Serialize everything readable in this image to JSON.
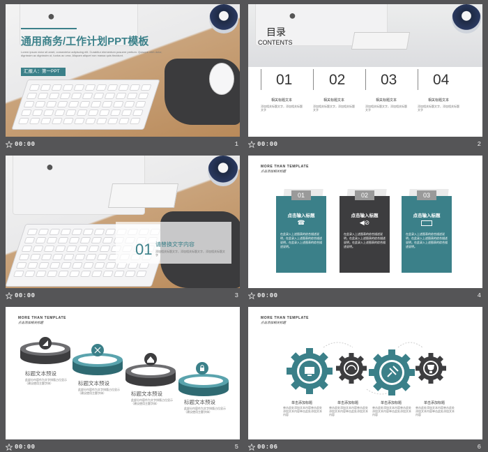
{
  "colors": {
    "accent": "#3b8089",
    "dark": "#3d3d3f",
    "grey": "#8a8a8a"
  },
  "slides": [
    {
      "number": "1",
      "time": "00:00",
      "title": "通用商务/工作计划PPT模板",
      "subtitle": "Lorem ipsum dolor sit amet, consectetur adipiscing elit. Curabitur elementum posuere pretium. Quisque nibh dolor, dignissim ac dignissim ut, luctus ac urna. Aliquam aliquet non massa quis tincidunt.",
      "reporter": "汇报人：第一PPT"
    },
    {
      "number": "2",
      "time": "00:00",
      "title": "目录",
      "subtitle": "CONTENTS",
      "items": [
        {
          "num": "01",
          "label": "相关标题文本",
          "desc": "添加相关标题文字，添加相关标题文字"
        },
        {
          "num": "02",
          "label": "相关标题文本",
          "desc": "添加相关标题文字，添加相关标题文字"
        },
        {
          "num": "03",
          "label": "相关标题文本",
          "desc": "添加相关标题文字，添加相关标题文字"
        },
        {
          "num": "04",
          "label": "相关标题文本",
          "desc": "添加相关标题文字，添加相关标题文字"
        }
      ]
    },
    {
      "number": "3",
      "time": "00:00",
      "section_num": "01",
      "section_title": "请替换文字内容",
      "section_desc": "添加相关标题文字，添加相关标题文字，添加相关标题文字"
    },
    {
      "number": "4",
      "time": "00:00",
      "header_en": "MORE THAN TEMPLATE",
      "header_cn": "点击添加相关标题",
      "cards": [
        {
          "num": "01",
          "title": "点击输入标题",
          "body": "在此录入上述图表的综合描述说明，在此录入上述图表的综合描述说明，在此录入上述图表的综合描述说明。"
        },
        {
          "num": "02",
          "title": "点击输入标题",
          "body": "在此录入上述图表的综合描述说明，在此录入上述图表的综合描述说明，在此录入上述图表的综合描述说明。"
        },
        {
          "num": "03",
          "title": "点击输入标题",
          "body": "在此录入上述图表的综合描述说明，在此录入上述图表的综合描述说明，在此录入上述图表的综合描述说明。"
        }
      ]
    },
    {
      "number": "5",
      "time": "00:00",
      "header_en": "MORE THAN TEMPLATE",
      "header_cn": "点击添加相关标题",
      "rings": [
        {
          "title": "标题文本预设",
          "desc": "此部分内容作为文字排版占位显示（建议使用主题字体）"
        },
        {
          "title": "标题文本预设",
          "desc": "此部分内容作为文字排版占位显示（建议使用主题字体）"
        },
        {
          "title": "标题文本预设",
          "desc": "此部分内容作为文字排版占位显示（建议使用主题字体）"
        },
        {
          "title": "标题文本预设",
          "desc": "此部分内容作为文字排版占位显示（建议使用主题字体）"
        }
      ]
    },
    {
      "number": "6",
      "time": "00:06",
      "header_en": "MORE THAN TEMPLATE",
      "header_cn": "点击添加相关标题",
      "gears": [
        {
          "title": "单击添加标题",
          "desc": "单击此处添加文本内容单击此处添加文本内容单击此处添加文本内容"
        },
        {
          "title": "单击添加标题",
          "desc": "单击此处添加文本内容单击此处添加文本内容单击此处添加文本内容"
        },
        {
          "title": "单击添加标题",
          "desc": "单击此处添加文本内容单击此处添加文本内容单击此处添加文本内容"
        },
        {
          "title": "单击添加标题",
          "desc": "单击此处添加文本内容单击此处添加文本内容单击此处添加文本内容"
        }
      ]
    }
  ]
}
